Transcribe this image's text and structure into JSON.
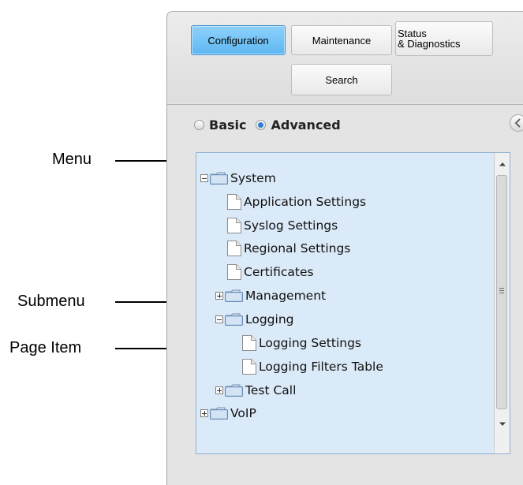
{
  "callouts": {
    "menu": "Menu",
    "submenu": "Submenu",
    "page_item": "Page Item"
  },
  "tabs": {
    "configuration": "Configuration",
    "maintenance": "Maintenance",
    "status_line1": "Status",
    "status_line2": "& Diagnostics",
    "search": "Search",
    "active": "configuration"
  },
  "mode": {
    "basic": "Basic",
    "advanced": "Advanced",
    "selected": "advanced"
  },
  "tree": {
    "system": "System",
    "application_settings": "Application Settings",
    "syslog_settings": "Syslog Settings",
    "regional_settings": "Regional Settings",
    "certificates": "Certificates",
    "management": "Management",
    "logging": "Logging",
    "logging_settings": "Logging Settings",
    "logging_filters_table": "Logging Filters Table",
    "test_call": "Test Call",
    "voip": "VoIP"
  },
  "colors": {
    "active_tab": "#5db7f1",
    "tree_background": "#dbeaf8",
    "panel_background": "#e4e4e4"
  }
}
